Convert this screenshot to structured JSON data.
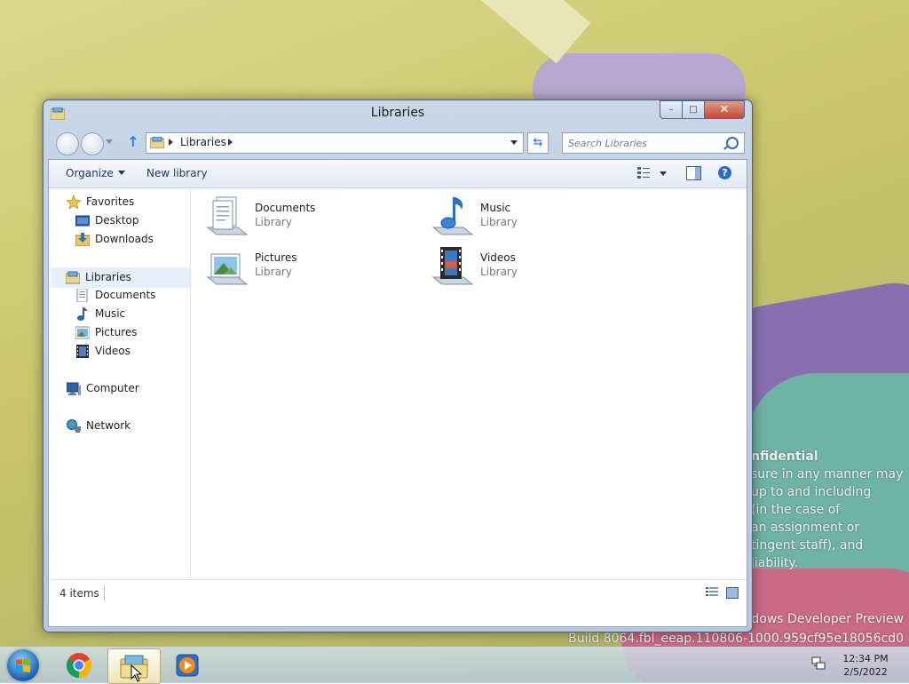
{
  "window": {
    "title": "Libraries",
    "caption": {
      "minimize": "–",
      "maximize": "□",
      "close": "✕"
    }
  },
  "address_bar": {
    "location": "Libraries"
  },
  "search": {
    "placeholder": "Search Libraries"
  },
  "toolbar": {
    "organize_label": "Organize",
    "new_library_label": "New library"
  },
  "navigation_pane": {
    "favorites": {
      "label": "Favorites",
      "items": [
        {
          "label": "Desktop"
        },
        {
          "label": "Downloads"
        }
      ]
    },
    "libraries": {
      "label": "Libraries",
      "items": [
        {
          "label": "Documents"
        },
        {
          "label": "Music"
        },
        {
          "label": "Pictures"
        },
        {
          "label": "Videos"
        }
      ]
    },
    "computer": {
      "label": "Computer"
    },
    "network": {
      "label": "Network"
    },
    "selected": "Libraries"
  },
  "libraries": [
    {
      "name": "Documents",
      "type": "Library",
      "icon": "documents-library-icon"
    },
    {
      "name": "Music",
      "type": "Library",
      "icon": "music-library-icon"
    },
    {
      "name": "Pictures",
      "type": "Library",
      "icon": "pictures-library-icon"
    },
    {
      "name": "Videos",
      "type": "Library",
      "icon": "videos-library-icon"
    }
  ],
  "status_bar": {
    "item_count": "4 items"
  },
  "watermark": {
    "title": "nfidential",
    "lines": [
      "sure in any manner may",
      "up to and including",
      "(in the case of",
      "an assignment or",
      "tingent staff), and",
      "liability."
    ]
  },
  "build_info": {
    "line1": "ndows Developer Preview",
    "line2": "Build 8064.fbl_eeap.110806-1000.959cf95e18056cd0"
  },
  "taskbar": {
    "pinned": [
      "chrome-icon",
      "explorer-icon",
      "media-player-icon"
    ],
    "active": "explorer-icon"
  },
  "clock": {
    "time": "12:34 PM",
    "date": "2/5/2022"
  },
  "colors": {
    "selection": "#e5f0fb",
    "window_frame": "#b6c8dc",
    "close_button": "#c24a36"
  }
}
